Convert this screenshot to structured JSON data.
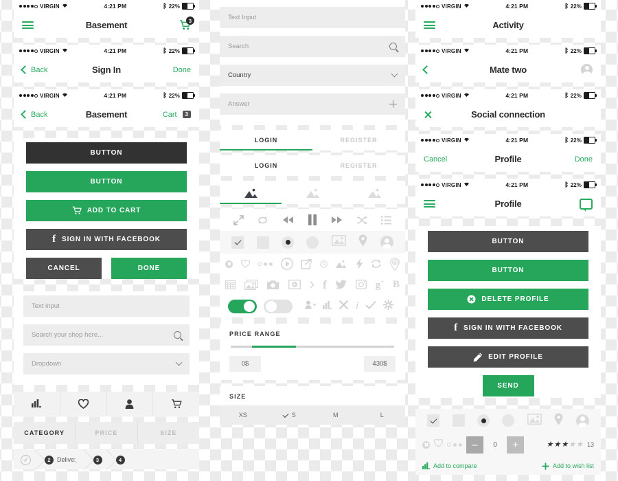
{
  "status_bar": {
    "carrier": "VIRGIN",
    "time": "4:21 PM",
    "battery_pct": "22%"
  },
  "left_column": {
    "navbars": [
      {
        "left_icon": "hamburger-icon",
        "title": "Basement",
        "right_icon": "cart-icon",
        "right_badge": "3"
      },
      {
        "left_label": "Back",
        "title": "Sign In",
        "right_label": "Done"
      },
      {
        "left_label": "Back",
        "title": "Basement",
        "right_label": "Cart",
        "right_badge": "3"
      }
    ],
    "buttons": [
      {
        "label": "BUTTON",
        "style": "dark"
      },
      {
        "label": "BUTTON",
        "style": "green"
      },
      {
        "label": "ADD TO CART",
        "style": "green",
        "icon": "cart-icon"
      },
      {
        "label": "SIGN IN WITH FACEBOOK",
        "style": "gray",
        "icon": "facebook-icon"
      }
    ],
    "pair_buttons": {
      "cancel": "CANCEL",
      "done": "DONE"
    },
    "fields": {
      "text_input": "Text input",
      "search": "Search your shop here...",
      "dropdown": "Dropdown"
    },
    "bottom_nav": [
      "chart-icon",
      "heart-icon",
      "user-icon",
      "cart-icon"
    ],
    "segments": [
      "CATEGORY",
      "PRICE",
      "SIZE"
    ],
    "steps": [
      {
        "num": "",
        "label": "",
        "state": "done"
      },
      {
        "num": "2",
        "label": "Delivery",
        "state": "active"
      },
      {
        "num": "3",
        "label": "",
        "state": "idle"
      },
      {
        "num": "4",
        "label": "",
        "state": "idle"
      }
    ]
  },
  "mid_column": {
    "fields": {
      "text_input": "Text Input",
      "search": "Search",
      "country": "Country",
      "answer": "Answer"
    },
    "tabs_a": [
      {
        "label": "LOGIN",
        "active": true
      },
      {
        "label": "REGISTER",
        "active": false
      }
    ],
    "tabs_b": [
      {
        "label": "LOGIN",
        "active": true
      },
      {
        "label": "REGISTER",
        "active": false
      }
    ],
    "image_tabs": [
      "image-icon",
      "image-icon",
      "image-icon"
    ],
    "media_icons": [
      "expand-icon",
      "repeat-icon",
      "rewind-icon",
      "pause-icon",
      "fast-forward-icon",
      "shuffle-icon",
      "playlist-icon"
    ],
    "control_icons": [
      "checkbox-checked",
      "checkbox-empty",
      "radio-selected",
      "radio-empty",
      "image-icon",
      "pin-icon",
      "avatar-icon"
    ],
    "social_row_1": [
      "close-circle-icon",
      "heart-icon",
      "dots-icon",
      "play-circle-icon",
      "share-icon",
      "clock-icon",
      "image-icon",
      "flash-icon",
      "refresh-icon",
      "pin-download-icon"
    ],
    "social_row_2": [
      "grid-icon",
      "gallery-icon",
      "camera-icon",
      "video-icon",
      "chevron-right-icon",
      "facebook-icon",
      "twitter-icon",
      "instagram-icon",
      "google-plus-icon",
      "blogger-icon"
    ],
    "toggle_row_icons": [
      "user-add-icon",
      "bars-icon",
      "close-icon",
      "info-icon",
      "check-icon",
      "settings-icon"
    ],
    "price_range": {
      "title": "PRICE RANGE",
      "min": "0$",
      "max": "430$",
      "fill_start_pct": 13,
      "fill_width_pct": 27
    },
    "size": {
      "title": "SIZE",
      "options": [
        {
          "label": "XS",
          "checked": false
        },
        {
          "label": "S",
          "checked": true
        },
        {
          "label": "M",
          "checked": false
        },
        {
          "label": "L",
          "checked": false
        }
      ]
    }
  },
  "right_column": {
    "navbars": [
      {
        "left_icon": "hamburger-icon",
        "title": "Activity"
      },
      {
        "left_icon": "chevron-left-icon",
        "title": "Mate two",
        "right_icon": "avatar-icon"
      },
      {
        "left_icon": "close-icon",
        "title": "Social connection"
      },
      {
        "left_label": "Cancel",
        "title": "Profile",
        "right_label": "Done"
      },
      {
        "left_icon": "hamburger-icon",
        "title": "Profile",
        "right_icon": "chat-icon"
      }
    ],
    "buttons": [
      {
        "label": "BUTTON",
        "style": "gray"
      },
      {
        "label": "BUTTON",
        "style": "green"
      },
      {
        "label": "DELETE PROFILE",
        "style": "green",
        "icon": "delete-icon"
      },
      {
        "label": "SIGN IN WITH FACEBOOK",
        "style": "gray",
        "icon": "facebook-icon"
      },
      {
        "label": "EDIT PROFILE",
        "style": "gray",
        "icon": "pencil-icon"
      }
    ],
    "send_button": "SEND",
    "control_icons": [
      "checkbox-checked",
      "checkbox-empty",
      "radio-selected",
      "radio-empty",
      "image-icon",
      "pin-icon",
      "avatar-icon"
    ],
    "quantity": {
      "minus": "–",
      "value": "0",
      "plus": "+"
    },
    "rating": {
      "filled": 3,
      "total": 5,
      "count": "13"
    },
    "links": {
      "compare": "Add to compare",
      "wishlist": "Add to wish list"
    }
  },
  "colors": {
    "green": "#26a65b",
    "dark": "#323232",
    "gray": "#4d4d4d",
    "field_bg": "#ededed"
  }
}
